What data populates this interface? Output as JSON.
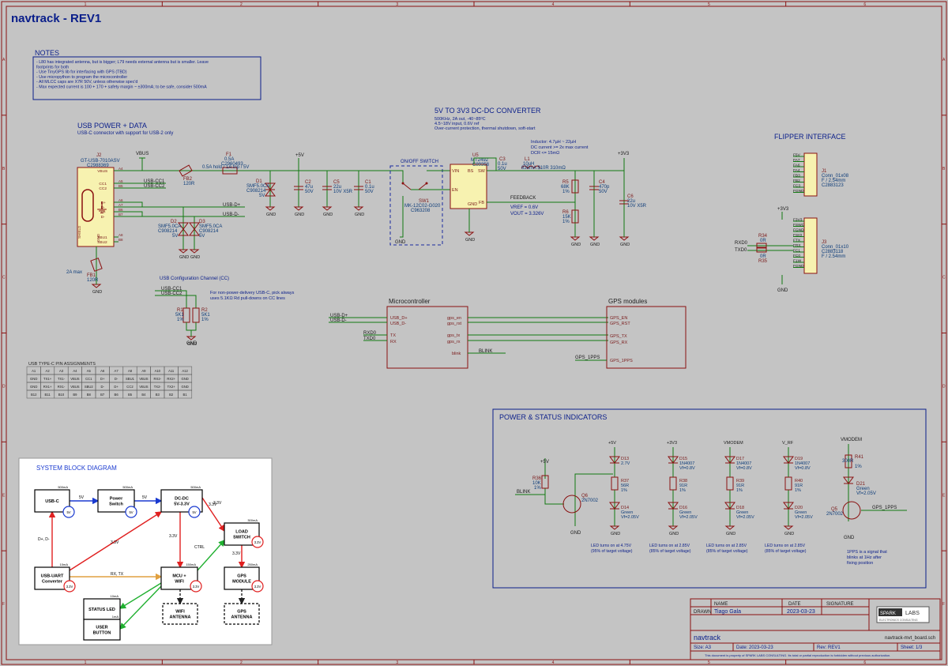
{
  "title": "navtrack - REV1",
  "border": {
    "cols": [
      "1",
      "2",
      "3",
      "4",
      "5",
      "6"
    ],
    "rows": [
      "A",
      "B",
      "C",
      "D",
      "E",
      "F"
    ]
  },
  "notes": {
    "heading": "NOTES",
    "lines": [
      "- L80 has integrated antenna, but is bigger; L79 needs external antenna but is smaller. Leave",
      "footprints for both",
      "- Use TinyGPS lib for interfacing with GPS (TBD)",
      "- Use micropython to program the microcontroller",
      "- All MLCC caps are X7R 50V, unless otherwise spec'd",
      "- Max expected current is 100 + 170 + safety margin ~ ±300mA; to be safe, consider 500mA"
    ]
  },
  "usb": {
    "heading": "USB POWER + DATA",
    "subtitle": "USB-C connector with support for USB-2 only",
    "conn_ref": "J2",
    "conn_val": "GT-USB-7010ASV",
    "conn_lcsc": "C2988369",
    "vbus": "VBUS",
    "f1_ref": "F1",
    "f1_val": "0.5A",
    "f1_lcsc": "C2960493",
    "f1_note": "0.5A hold / 1A trip / 5V",
    "fb2_ref": "FB2",
    "fb2_val": "120R",
    "d1_ref": "D1",
    "d1_val": "SMF5.0CA",
    "d1_lcsc": "C908214",
    "d1_v": "5V",
    "c2_ref": "C2",
    "c2_val": "47u",
    "c2_v": "50V",
    "c5_ref": "C5",
    "c5_val": "22u",
    "c5_v": "10V X5R",
    "c1_ref": "C1",
    "c1_val": "0.1u",
    "c1_v": "50V",
    "d2_ref": "D2",
    "d2_val": "SMF5.0CA",
    "d2_lcsc": "C908214",
    "d2_v": "5V",
    "d3_ref": "D3",
    "d3_val": "SMF5.0CA",
    "d3_lcsc": "C908214",
    "d3_v": "5V",
    "fb1_ref": "FB1",
    "fb1_val": "120R",
    "fb1_note": "2A max",
    "p5v": "+5V",
    "gnd": "GND",
    "pins": [
      "VBUS",
      "CC1",
      "CC2",
      "D+",
      "D-",
      "D+",
      "D-",
      "SHIELD",
      "GND",
      "SBU1",
      "SBU2"
    ],
    "pinnums": [
      "A4",
      "A5",
      "B5",
      "A6",
      "A7",
      "B6",
      "B7",
      "S1",
      "A1",
      "A8",
      "B8"
    ],
    "labels": [
      "USB-CC1",
      "USB-CC2",
      "USB-D+",
      "USB-D-"
    ]
  },
  "cc": {
    "heading": "USB Configuration Channel (CC)",
    "labels": [
      "USB-CC1",
      "USB-CC2"
    ],
    "r1": [
      "R1",
      "5K1",
      "1%"
    ],
    "r2": [
      "R2",
      "5K1",
      "1%"
    ],
    "note": [
      "For non-power-delivery USB-C, pick always",
      "uses 5.1KΩ Rd pull-downs on CC lines"
    ],
    "gnd": "GND"
  },
  "pin_table": {
    "title": "USB TYPE-C PIN ASSIGNMENTS",
    "rows": [
      [
        "A1",
        "A2",
        "A3",
        "A4",
        "A5",
        "A6",
        "A7",
        "A8",
        "A9",
        "A10",
        "A11",
        "A12"
      ],
      [
        "GND",
        "TX1+",
        "TX1-",
        "VBUS",
        "CC1",
        "D+",
        "D-",
        "SBU1",
        "VBUS",
        "RX2-",
        "RX2+",
        "GND"
      ],
      [
        "GND",
        "RX1+",
        "RX1-",
        "VBUS",
        "SBU2",
        "D-",
        "D+",
        "CC2",
        "VBUS",
        "TX2-",
        "TX2+",
        "GND"
      ],
      [
        "B12",
        "B11",
        "B10",
        "B9",
        "B8",
        "B7",
        "B6",
        "B5",
        "B4",
        "B3",
        "B2",
        "B1"
      ]
    ]
  },
  "dcdc": {
    "heading": "5V TO 3V3 DC-DC CONVERTER",
    "specs": [
      "500KHz, 2A out, -40~85ºC",
      "4.5~18V input, 0.6V ref",
      "Over-current protection, thermal shutdown, soft-start"
    ],
    "switch_title": "ON/OFF SWITCH",
    "sw_ref": "SW1",
    "sw_val": "MK-12C02-G020",
    "sw_lcsc": "C963208",
    "u_ref": "U5",
    "u_val": "MT2492",
    "u_lcsc": "C89358",
    "pins": [
      "VIN",
      "EN",
      "BS",
      "SW",
      "FB",
      "GND"
    ],
    "c3": [
      "C3",
      "0.1u",
      "50V"
    ],
    "l1": [
      "L1",
      "10uH"
    ],
    "l1_note": "835mA  $10R  310mΩ",
    "inductor_note": [
      "Inductor: 4.7µH ~ 22µH",
      "DC current >= 2x max current",
      "DCR <= 15mΩ"
    ],
    "r5": [
      "R5",
      "68K",
      "1%"
    ],
    "r6": [
      "R6",
      "15K",
      "1%"
    ],
    "c4": [
      "C4",
      "470p",
      "50V"
    ],
    "c6": [
      "C6",
      "22u",
      "10V X5R"
    ],
    "feedback": "FEEDBACK",
    "vref": "VREF = 0.6V",
    "vout": "VOUT = 3.326V",
    "p3v3": "+3V3",
    "gnd": "GND"
  },
  "flipper": {
    "heading": "FLIPPER INTERFACE",
    "j1": [
      "J1",
      "Conn_01x08",
      "C2883123"
    ],
    "j1_pins": [
      "F5V",
      "FA7",
      "FA6",
      "FA4",
      "FB3",
      "FB2",
      "FC3",
      "FGND"
    ],
    "j3": [
      "J3",
      "Conn_01x10",
      "C2883118",
      "F / 2.54mm"
    ],
    "j3_pins": [
      "F3V3",
      "FSWC",
      "FGND",
      "FSIO",
      "FTX",
      "FRX",
      "FC1",
      "FC0",
      "F1W",
      "FGND"
    ],
    "j1_note": "F / 2.54mm",
    "r34": [
      "R34",
      "0R"
    ],
    "r35": [
      "R35",
      "0R"
    ],
    "rxd": "RXD0",
    "txd": "TXD0",
    "p3v3": "+3V3",
    "gnd": "GND"
  },
  "mcu": {
    "title": "Microcontroller",
    "left": [
      "USB_D+",
      "USB_D-",
      "TX",
      "RX"
    ],
    "right": [
      "gps_en",
      "gps_rst",
      "gps_tx",
      "gps_rx",
      "blink"
    ],
    "nets_left": [
      "USB-D+",
      "USB-D-",
      "RXD0",
      "TXD0"
    ],
    "blink": "BLINK"
  },
  "gps": {
    "title": "GPS modules",
    "pins": [
      "GPS_EN",
      "GPS_RST",
      "GPS_TX",
      "GPS_RX",
      "GPS_1PPS"
    ],
    "net": "GPS_1PPS"
  },
  "indicators": {
    "heading": "POWER & STATUS INDICATORS",
    "columns": [
      {
        "rail": "+5V",
        "d1": [
          "D13",
          "2.7V"
        ],
        "r": [
          "R37",
          "56R",
          "1%"
        ],
        "led": [
          "D14",
          "Green",
          "Vf=2.05V"
        ],
        "note": [
          "LED turns on at 4.75V",
          "(95% of target voltage)"
        ]
      },
      {
        "rail": "+3V3",
        "d1": [
          "D15",
          "1N4007",
          "Vf=0.8V"
        ],
        "r": [
          "R38",
          "91R",
          "1%"
        ],
        "led": [
          "D16",
          "Green",
          "Vf=2.05V"
        ],
        "note": [
          "LED turns on at 2.85V",
          "(85% of target voltage)"
        ]
      },
      {
        "rail": "VMODEM",
        "d1": [
          "D17",
          "1N4007",
          "Vf=0.8V"
        ],
        "r": [
          "R39",
          "91R",
          "1%"
        ],
        "led": [
          "D18",
          "Green",
          "Vf=2.05V"
        ],
        "note": [
          "LED turns on at 2.85V",
          "(85% of target voltage)"
        ]
      },
      {
        "rail": "V_RF",
        "d1": [
          "D19",
          "1N4007",
          "Vf=0.8V"
        ],
        "r": [
          "R40",
          "91R",
          "1%"
        ],
        "led": [
          "D20",
          "Green",
          "Vf=2.05V"
        ],
        "note": [
          "LED turns on at 2.85V",
          "(85% of target voltage)"
        ]
      }
    ],
    "blink": {
      "rail": "+5V",
      "r": [
        "R36",
        "10K",
        "1%"
      ],
      "q": [
        "Q6",
        "2N7002"
      ],
      "net": "BLINK"
    },
    "pps": {
      "rail": "VMODEM",
      "r": [
        "R41",
        "300R",
        "1%"
      ],
      "led": [
        "D21",
        "Green",
        "Vf=2.05V"
      ],
      "q": [
        "Q5",
        "2N7002"
      ],
      "net": "GPS_1PPS",
      "note": [
        "1PPS is a signal that",
        "blinks at 1Hz after",
        "fixing position"
      ]
    },
    "gnd": "GND"
  },
  "block_diagram": {
    "title": "SYSTEM BLOCK DIAGRAM",
    "blocks": [
      {
        "id": "usbc",
        "label": "USB-C",
        "cur": "500mA"
      },
      {
        "id": "psw",
        "label": "Power\nSwitch",
        "cur": "500mA"
      },
      {
        "id": "dcdc",
        "label": "DC-DC\n5V-3.3V",
        "cur": "500mA"
      },
      {
        "id": "load",
        "label": "LOAD\nSWITCH",
        "cur": "300mA"
      },
      {
        "id": "uart",
        "label": "USB-UART\nConverter",
        "cur": "10mA"
      },
      {
        "id": "mcu",
        "label": "MCU +\nWIFI",
        "cur": "150mA"
      },
      {
        "id": "gps",
        "label": "GPS\nMODULE",
        "cur": "250mA"
      },
      {
        "id": "led",
        "label": "STATUS LED",
        "cur": "10mA"
      },
      {
        "id": "btn",
        "label": "USER\nBUTTON",
        "cur": "1mA"
      },
      {
        "id": "wifia",
        "label": "WIFI\nANTENNA",
        "cur": ""
      },
      {
        "id": "gpsa",
        "label": "GPS\nANTENNA",
        "cur": ""
      }
    ],
    "badges": [
      "5V",
      "5V",
      "5V",
      "3.3V",
      "3.3V",
      "3.3V",
      "3.3V"
    ],
    "edge_labels": [
      "5V",
      "5V",
      "3.3V",
      "3.3V",
      "3.3V",
      "D+, D-",
      "3.3V",
      "RX, TX",
      "CTRL",
      "3.3V"
    ]
  },
  "title_block": {
    "h_name": "NAME",
    "h_date": "DATE",
    "h_sig": "SIGNATURE",
    "drawn": "DRAWN",
    "name": "Tiago Gala",
    "date": "2023-03-23",
    "logo_a": "SPARK",
    "logo_b": "LABS",
    "logo_sub": "ELECTRONICS CONSULTING",
    "project": "navtrack",
    "file": "navtrack-mvt_board.sch",
    "size": "Size: A3",
    "date2": "Date: 2023-03-23",
    "rev": "Rev: REV1",
    "sheet": "Sheet: 1/3",
    "footer": "This document is property of SPARK LABS CONSULTING. Its total or partial reproduction is forbidden without previous authorization."
  },
  "colors": {
    "bg": "#c4c4c4",
    "wire": "#127a12",
    "component": "#8a1010",
    "text_blue": "#0a1e8a",
    "body": "#f7f2b0"
  }
}
